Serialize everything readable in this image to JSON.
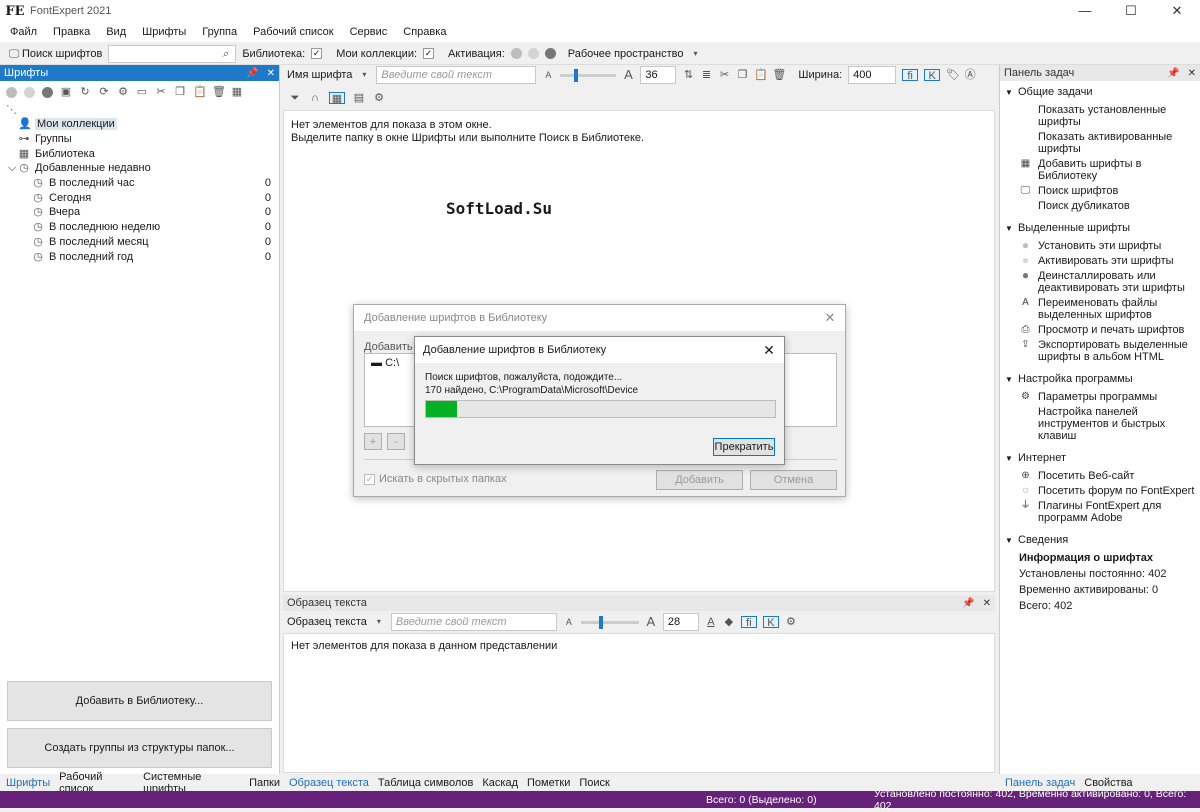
{
  "app": {
    "logo": "FE",
    "title": "FontExpert 2021"
  },
  "window_buttons": [
    "—",
    "☐",
    "✕"
  ],
  "menu": [
    "Файл",
    "Правка",
    "Вид",
    "Шрифты",
    "Группа",
    "Рабочий список",
    "Сервис",
    "Справка"
  ],
  "toolbar": {
    "search_label": "Поиск шрифтов",
    "search_value": "",
    "library_label": "Библиотека:",
    "collections_label": "Мои коллекции:",
    "activation_label": "Активация:",
    "workspace_label": "Рабочее пространство"
  },
  "left_panel": {
    "title": "Шрифты",
    "tree": [
      {
        "label": "Мои коллекции",
        "icon": "user-icon",
        "count": "",
        "indent": 0
      },
      {
        "label": "Группы",
        "icon": "groups-icon",
        "count": "",
        "indent": 0
      },
      {
        "label": "Библиотека",
        "icon": "library-icon",
        "count": "",
        "indent": 0
      },
      {
        "label": "Добавленные недавно",
        "icon": "clock-icon",
        "count": "",
        "indent": 0
      },
      {
        "label": "В последний час",
        "icon": "clock-icon",
        "count": "0",
        "indent": 1
      },
      {
        "label": "Сегодня",
        "icon": "clock-icon",
        "count": "0",
        "indent": 1
      },
      {
        "label": "Вчера",
        "icon": "clock-icon",
        "count": "0",
        "indent": 1
      },
      {
        "label": "В последнюю неделю",
        "icon": "clock-icon",
        "count": "0",
        "indent": 1
      },
      {
        "label": "В последний месяц",
        "icon": "clock-icon",
        "count": "0",
        "indent": 1
      },
      {
        "label": "В последний год",
        "icon": "clock-icon",
        "count": "0",
        "indent": 1
      }
    ],
    "add_library_button": "Добавить в Библиотеку...",
    "create_groups_button": "Создать группы из структуры папок...",
    "tabs": [
      "Шрифты",
      "Рабочий список",
      "Системные шрифты",
      "Папки"
    ]
  },
  "center": {
    "font_name_label": "Имя шрифта",
    "text_placeholder": "Введите свой текст",
    "size_value": "36",
    "width_label": "Ширина:",
    "width_value": "400",
    "empty_line1": "Нет элементов для показа в этом окне.",
    "empty_line2": "Выделите папку в окне Шрифты или выполните Поиск в Библиотеке.",
    "watermark": "SoftLoad.Su"
  },
  "sample_panel": {
    "title": "Образец текста",
    "label": "Образец текста",
    "text_placeholder": "Введите свой текст",
    "size_value": "28",
    "empty_text": "Нет элементов для показа в данном представлении",
    "tabs": [
      "Образец текста",
      "Таблица символов",
      "Каскад",
      "Пометки",
      "Поиск"
    ]
  },
  "dialog_back": {
    "title": "Добавление шрифтов в Библиотеку",
    "add_label": "Добавить ш",
    "folder_item": "C:\\",
    "hidden_folders_label": "Искать в скрытых папках",
    "add_button": "Добавить",
    "cancel_button": "Отмена"
  },
  "dialog_front": {
    "title": "Добавление шрифтов в Библиотеку",
    "status_line1": "Поиск шрифтов, пожалуйста, подождите...",
    "status_line2": "170 найдено, C:\\ProgramData\\Microsoft\\Device",
    "progress": 0.09,
    "stop_button": "Прекратить"
  },
  "task_panel": {
    "title": "Панель задач",
    "sections": [
      {
        "title": "Общие задачи",
        "items": [
          {
            "label": "Показать установленные шрифты",
            "icon": ""
          },
          {
            "label": "Показать активированные шрифты",
            "icon": ""
          },
          {
            "label": "Добавить шрифты в Библиотеку",
            "icon": "library-icon"
          },
          {
            "label": "Поиск шрифтов",
            "icon": "search-icon"
          },
          {
            "label": "Поиск дубликатов",
            "icon": ""
          }
        ]
      },
      {
        "title": "Выделенные шрифты",
        "items": [
          {
            "label": "Установить эти шрифты",
            "icon": "circle-gray-icon"
          },
          {
            "label": "Активировать эти шрифты",
            "icon": "circle-light-icon"
          },
          {
            "label": "Деинсталлировать или деактивировать эти шрифты",
            "icon": "circle-dark-icon"
          },
          {
            "label": "Переименовать файлы выделенных шрифтов",
            "icon": "rename-icon"
          },
          {
            "label": "Просмотр и печать шрифтов",
            "icon": "print-icon"
          },
          {
            "label": "Экспортировать выделенные шрифты в альбом HTML",
            "icon": "export-icon"
          }
        ]
      },
      {
        "title": "Настройка программы",
        "items": [
          {
            "label": "Параметры программы",
            "icon": "gear-icon"
          },
          {
            "label": "Настройка панелей инструментов и быстрых клавиш",
            "icon": ""
          }
        ]
      },
      {
        "title": "Интернет",
        "items": [
          {
            "label": "Посетить Веб-сайт",
            "icon": "globe-icon"
          },
          {
            "label": "Посетить форум по FontExpert",
            "icon": "chat-icon"
          },
          {
            "label": "Плагины FontExpert для программ Adobe",
            "icon": "plug-icon"
          }
        ]
      }
    ],
    "info": {
      "title": "Сведения",
      "heading": "Информация о шрифтах",
      "installed": "Установлены постоянно: 402",
      "activated": "Временно активированы: 0",
      "total": "Всего: 402"
    },
    "tabs": [
      "Панель задач",
      "Свойства"
    ]
  },
  "status_bar": {
    "left": "Всего: 0 (Выделено: 0)",
    "right": "Установлено постоянно: 402, Временно активировано: 0, Всего: 402"
  },
  "colors": {
    "accent": "#1e7ac8",
    "status_bar": "#68217a",
    "progress": "#06b025"
  }
}
